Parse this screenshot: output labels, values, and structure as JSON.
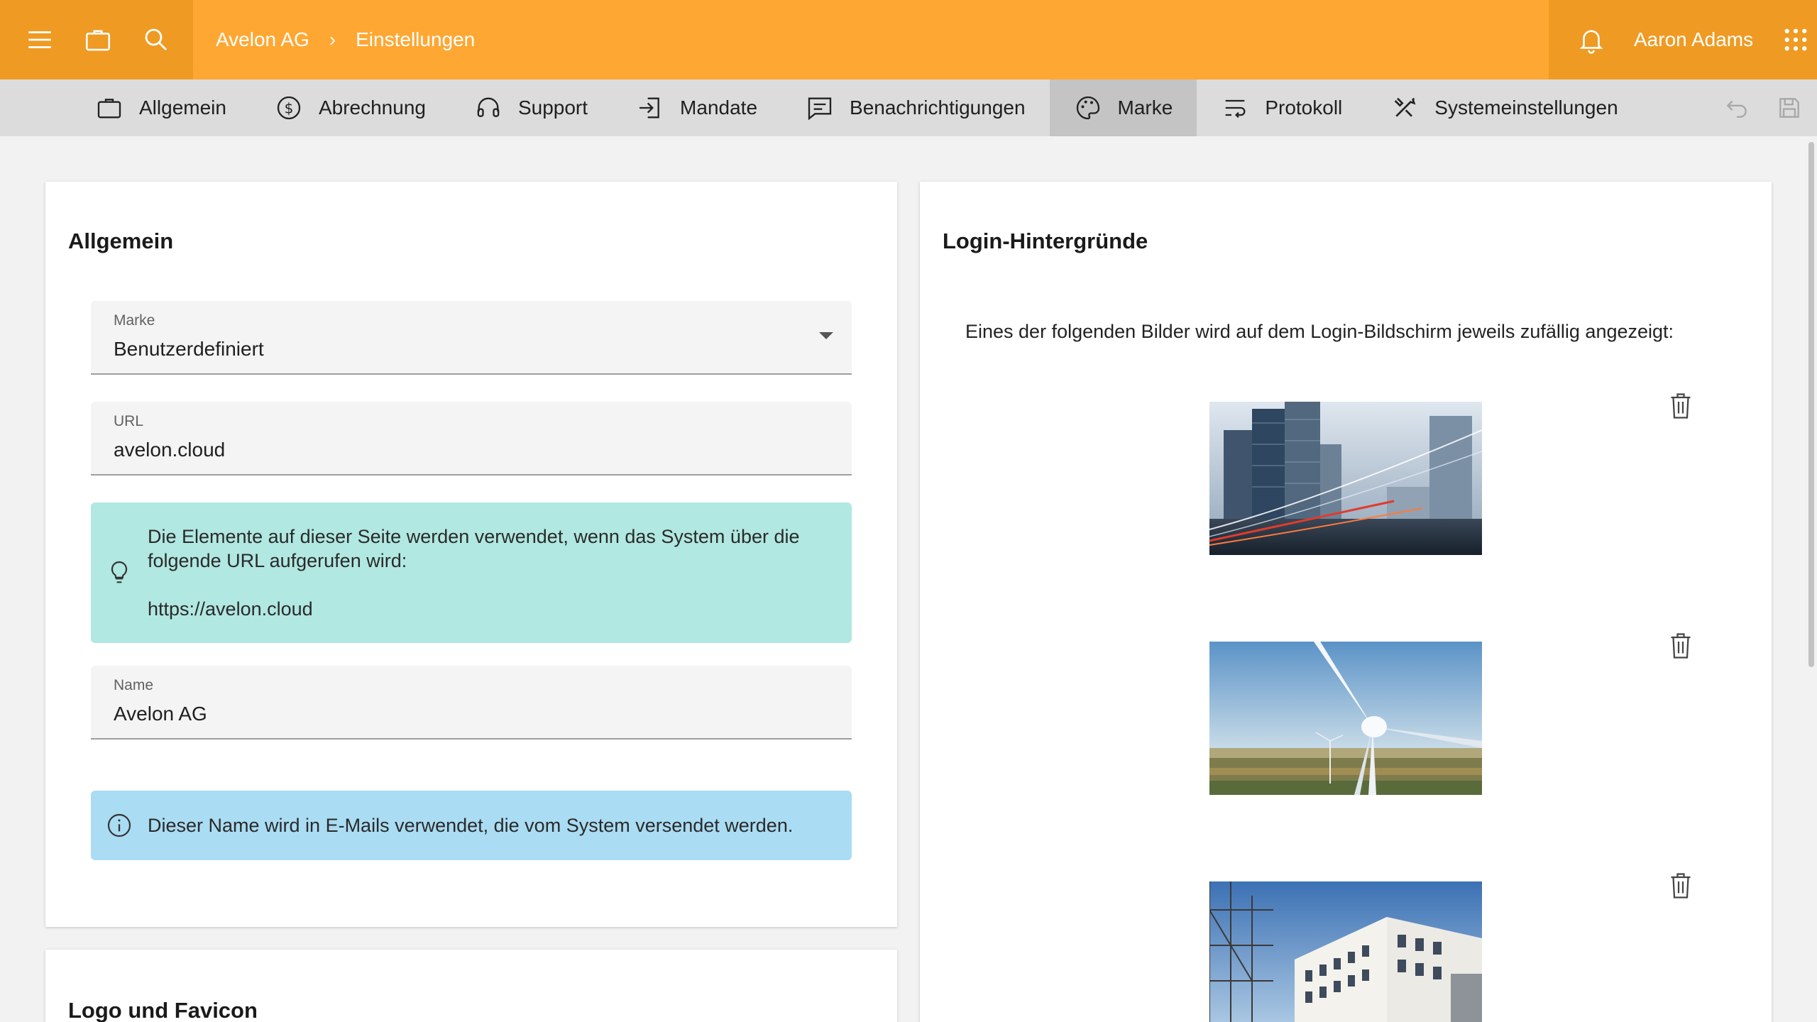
{
  "topbar": {
    "breadcrumb": [
      "Avelon AG",
      "Einstellungen"
    ],
    "breadcrumb_separator": "›",
    "user_name": "Aaron Adams",
    "accent_color": "#ffa733"
  },
  "tabs": [
    {
      "label": "Allgemein",
      "icon": "briefcase-icon"
    },
    {
      "label": "Abrechnung",
      "icon": "dollar-circle-icon"
    },
    {
      "label": "Support",
      "icon": "headset-icon"
    },
    {
      "label": "Mandate",
      "icon": "login-icon"
    },
    {
      "label": "Benachrichtigungen",
      "icon": "message-icon"
    },
    {
      "label": "Marke",
      "icon": "palette-icon",
      "active": true
    },
    {
      "label": "Protokoll",
      "icon": "list-wrap-icon"
    },
    {
      "label": "Systemeinstellungen",
      "icon": "tools-icon"
    }
  ],
  "general": {
    "title": "Allgemein",
    "brand_label": "Marke",
    "brand_value": "Benutzerdefiniert",
    "url_label": "URL",
    "url_value": "avelon.cloud",
    "url_notice_line1": "Die Elemente auf dieser Seite werden verwendet, wenn das System über die",
    "url_notice_line2": "folgende URL aufgerufen wird:",
    "url_notice_link": "https://avelon.cloud",
    "name_label": "Name",
    "name_value": "Avelon AG",
    "name_notice": "Dieser Name wird in E-Mails verwendet, die vom System versendet werden."
  },
  "logo": {
    "title": "Logo und Favicon"
  },
  "backgrounds": {
    "title": "Login-Hintergründe",
    "description": "Eines der folgenden Bilder wird auf dem Login-Bildschirm jeweils zufällig angezeigt:",
    "images": [
      "city-skyline-image",
      "wind-turbine-image",
      "office-building-image"
    ]
  }
}
